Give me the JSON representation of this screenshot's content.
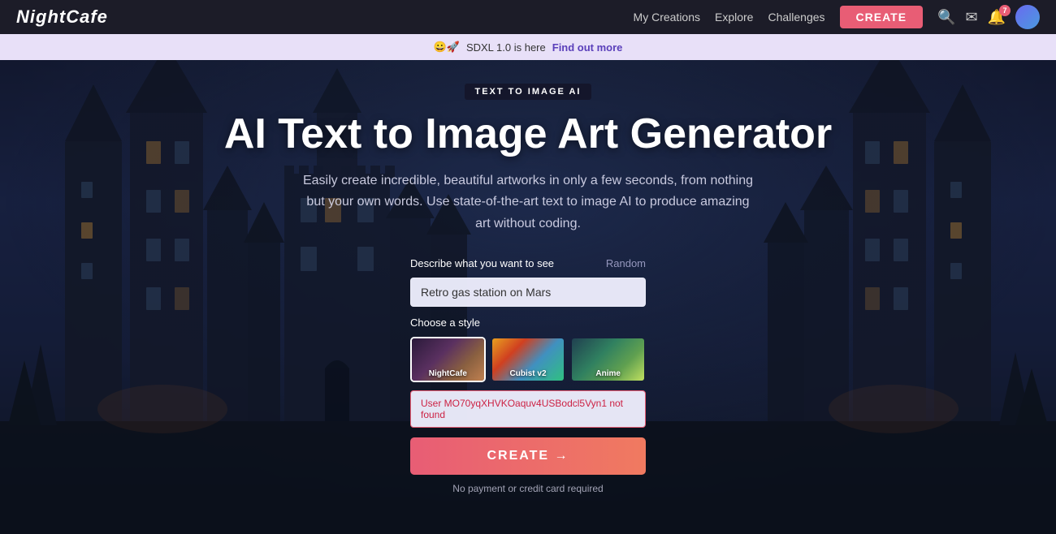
{
  "navbar": {
    "logo": "NightCafe",
    "links": [
      {
        "label": "My Creations",
        "id": "my-creations"
      },
      {
        "label": "Explore",
        "id": "explore"
      },
      {
        "label": "Challenges",
        "id": "challenges"
      }
    ],
    "create_label": "CREATE",
    "icons": {
      "search": "🔍",
      "mail": "✉",
      "bell": "🔔",
      "bell_badge": "7",
      "avatar_initials": ""
    }
  },
  "announcement": {
    "emoji": "😀🚀",
    "text": "SDXL 1.0 is here",
    "link_text": "Find out more",
    "link_url": "#"
  },
  "hero": {
    "badge": "TEXT TO IMAGE AI",
    "title": "AI Text to Image Art Generator",
    "subtitle": "Easily create incredible, beautiful artworks in only a few seconds, from nothing but your own words. Use state-of-the-art text to image AI to produce amazing art without coding.",
    "form": {
      "describe_label": "Describe what you want to see",
      "random_label": "Random",
      "prompt_value": "Retro gas station on Mars",
      "prompt_placeholder": "Retro gas station on Mars",
      "style_label": "Choose a style",
      "styles": [
        {
          "id": "nightcafe",
          "label": "NightCafe",
          "selected": true
        },
        {
          "id": "cubist",
          "label": "Cubist v2",
          "selected": false
        },
        {
          "id": "anime",
          "label": "Anime",
          "selected": false
        }
      ],
      "error_text": "User MO70yqXHVKOaquv4USBodcl5Vyn1 not found",
      "create_label": "CREATE →",
      "no_payment_text": "No payment or credit card required"
    }
  }
}
